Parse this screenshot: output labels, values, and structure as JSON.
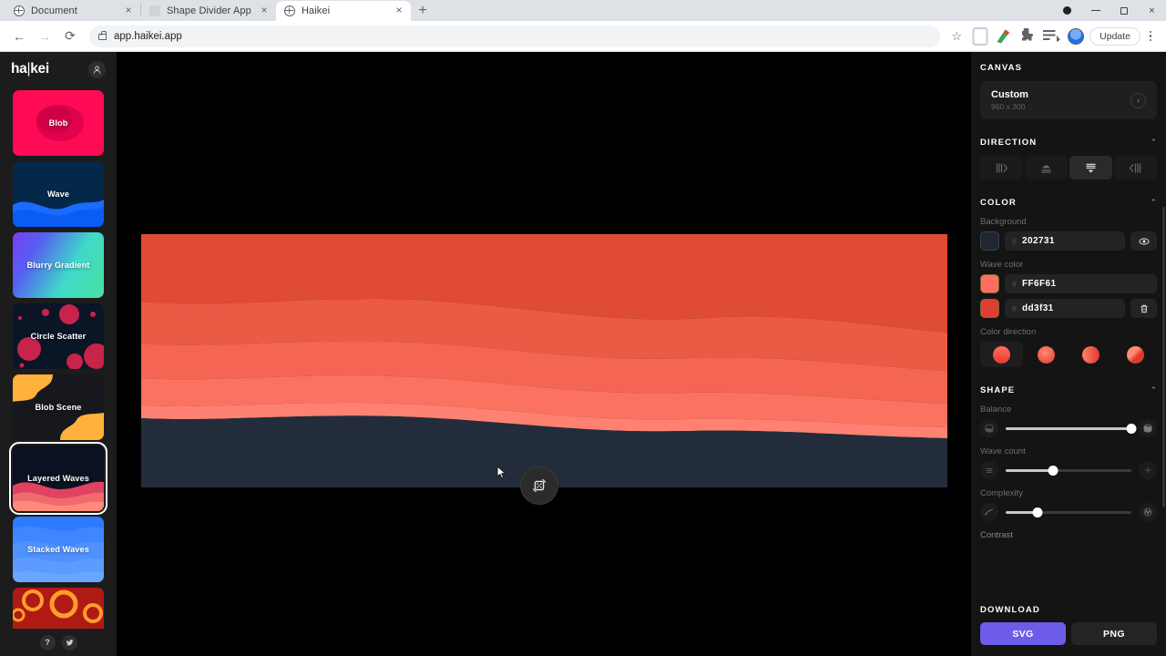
{
  "browser": {
    "tabs": [
      {
        "title": "Document",
        "favicon": "globe-icon",
        "active": false
      },
      {
        "title": "Shape Divider App",
        "favicon": "blank-icon",
        "active": false
      },
      {
        "title": "Haikei",
        "favicon": "globe-icon",
        "active": true
      }
    ],
    "new_tab_label": "+",
    "close_label": "×",
    "back_label": "←",
    "forward_label": "→",
    "reload_label": "⟳",
    "url": "app.haikei.app",
    "bookmark_label": "☆",
    "update_label": "Update",
    "window": {
      "minimize": "–",
      "maximize": "□",
      "close": "×"
    }
  },
  "sidebar": {
    "logo_left": "ha",
    "logo_bar": "|",
    "logo_right": "kei",
    "presets": [
      {
        "label": "Blob",
        "selected": false
      },
      {
        "label": "Wave",
        "selected": false
      },
      {
        "label": "Blurry Gradient",
        "selected": false
      },
      {
        "label": "Circle Scatter",
        "selected": false
      },
      {
        "label": "Blob Scene",
        "selected": false
      },
      {
        "label": "Layered Waves",
        "selected": true
      },
      {
        "label": "Stacked Waves",
        "selected": false
      },
      {
        "label": "",
        "selected": false
      }
    ],
    "footer": {
      "help_label": "?",
      "twitter_label": "twitter-icon"
    }
  },
  "panel": {
    "canvas": {
      "heading": "CANVAS",
      "preset_name": "Custom",
      "dimensions": "960 x 300",
      "arrow": "›"
    },
    "direction": {
      "heading": "DIRECTION",
      "collapse": "⌃",
      "options": [
        {
          "name": "direction-right",
          "active": false
        },
        {
          "name": "direction-up",
          "active": false
        },
        {
          "name": "direction-down",
          "active": true
        },
        {
          "name": "direction-left",
          "active": false
        }
      ]
    },
    "color": {
      "heading": "COLOR",
      "collapse": "⌃",
      "background_label": "Background",
      "background_hex": "202731",
      "background_swatch": "#202731",
      "toggle_icon": "eye-icon",
      "wave_label": "Wave color",
      "waves": [
        {
          "hex": "FF6F61",
          "swatch": "#ff6f61",
          "action": "none"
        },
        {
          "hex": "dd3f31",
          "swatch": "#dd3f31",
          "action": "trash-icon"
        }
      ],
      "color_direction_label": "Color direction",
      "directions": [
        {
          "name": "gradient-vertical",
          "active": true
        },
        {
          "name": "gradient-radial",
          "active": false
        },
        {
          "name": "gradient-horizontal",
          "active": false
        },
        {
          "name": "gradient-diagonal",
          "active": false
        }
      ]
    },
    "shape": {
      "heading": "SHAPE",
      "collapse": "⌃",
      "sliders": [
        {
          "label": "Balance",
          "value": 100,
          "left_icon": "balance-low-icon",
          "right_icon": "balance-high-icon"
        },
        {
          "label": "Wave count",
          "value": 38,
          "left_icon": "minus-icon",
          "right_icon": "plus-icon"
        },
        {
          "label": "Complexity",
          "value": 25,
          "left_icon": "complexity-low-icon",
          "right_icon": "complexity-high-icon"
        }
      ],
      "contrast_label": "Contrast"
    },
    "download": {
      "heading": "DOWNLOAD",
      "svg_label": "SVG",
      "png_label": "PNG",
      "accent": "#6c5ce7"
    }
  },
  "canvas_art": {
    "background": "#202731",
    "layers": [
      {
        "name": "wave-layer-1",
        "color": "#e04b36"
      },
      {
        "name": "wave-layer-2",
        "color": "#ea5a45"
      },
      {
        "name": "wave-layer-3",
        "color": "#f465534"
      },
      {
        "name": "wave-layer-4",
        "color": "#fb7261"
      },
      {
        "name": "wave-layer-5",
        "color": "#ff8172"
      }
    ],
    "randomize_icon": "shuffle-dice-icon",
    "cursor": "pointer-cursor"
  }
}
